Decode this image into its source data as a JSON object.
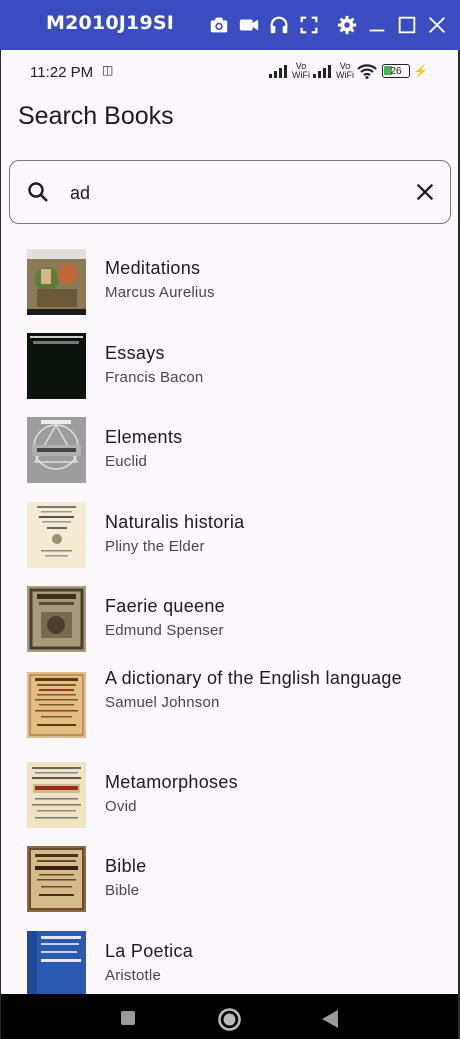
{
  "emulator": {
    "device_name": "M2010J19SI",
    "icons": [
      "camera-icon",
      "video-icon",
      "headphones-icon",
      "fullscreen-icon",
      "settings-icon",
      "minimize-icon",
      "maximize-icon",
      "close-icon"
    ]
  },
  "status_bar": {
    "time": "11:22 PM",
    "battery": "26",
    "network_labels": [
      "Vo WiFi",
      "Vo WiFi"
    ]
  },
  "page": {
    "title": "Search Books"
  },
  "search": {
    "value": "ad"
  },
  "books": [
    {
      "title": "Meditations",
      "author": "Marcus Aurelius",
      "cover": "meditations"
    },
    {
      "title": "Essays",
      "author": "Francis Bacon",
      "cover": "essays"
    },
    {
      "title": "Elements",
      "author": "Euclid",
      "cover": "elements"
    },
    {
      "title": "Naturalis historia",
      "author": "Pliny the Elder",
      "cover": "naturalis"
    },
    {
      "title": "Faerie queene",
      "author": "Edmund Spenser",
      "cover": "faerie"
    },
    {
      "title": "A dictionary of the English language",
      "author": "Samuel Johnson",
      "cover": "dictionary"
    },
    {
      "title": "Metamorphoses",
      "author": "Ovid",
      "cover": "metamorphoses"
    },
    {
      "title": "Bible",
      "author": "Bible",
      "cover": "bible"
    },
    {
      "title": "La Poetica",
      "author": "Aristotle",
      "cover": "poetica"
    }
  ],
  "colors": {
    "emulator_bar": "#3b4cc0",
    "screen_bg": "#fdf7fe",
    "text_primary": "#1d1b20",
    "text_secondary": "#49454f"
  }
}
